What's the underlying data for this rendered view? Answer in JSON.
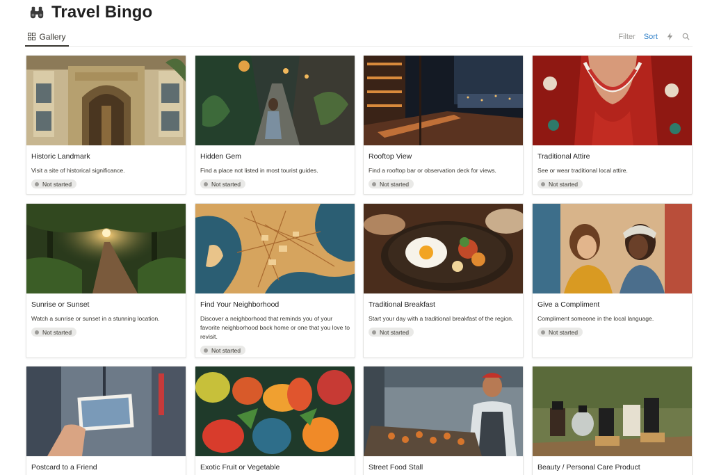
{
  "page": {
    "title": "Travel Bingo",
    "icon": "binoculars-icon"
  },
  "view": {
    "tab_label": "Gallery",
    "tab_icon": "gallery-grid-icon",
    "toolbar": {
      "filter_label": "Filter",
      "sort_label": "Sort",
      "automation_icon": "lightning-icon",
      "search_icon": "search-icon"
    }
  },
  "colors": {
    "sort_accent": "#2f80c8",
    "status_badge_bg": "#e9e9e7",
    "status_dot": "#9b9a97"
  },
  "cards": [
    {
      "name": "Historic Landmark",
      "description": "Visit a site of historical significance.",
      "status": "Not started"
    },
    {
      "name": "Hidden Gem",
      "description": "Find a place not listed in most tourist guides.",
      "status": "Not started"
    },
    {
      "name": "Rooftop View",
      "description": "Find a rooftop bar or observation deck for views.",
      "status": "Not started"
    },
    {
      "name": "Traditional Attire",
      "description": "See or wear traditional local attire.",
      "status": "Not started"
    },
    {
      "name": "Sunrise or Sunset",
      "description": "Watch a sunrise or sunset in a stunning location.",
      "status": "Not started"
    },
    {
      "name": "Find Your Neighborhood",
      "description": "Discover a neighborhood that reminds you of your favorite neighborhood back home or one that you love to revisit.",
      "status": "Not started"
    },
    {
      "name": "Traditional Breakfast",
      "description": "Start your day with a traditional breakfast of the region.",
      "status": "Not started"
    },
    {
      "name": "Give a Compliment",
      "description": "Compliment someone in the local language.",
      "status": "Not started"
    },
    {
      "name": "Postcard to a Friend"
    },
    {
      "name": "Exotic Fruit or Vegetable"
    },
    {
      "name": "Street Food Stall"
    },
    {
      "name": "Beauty / Personal Care Product"
    }
  ]
}
